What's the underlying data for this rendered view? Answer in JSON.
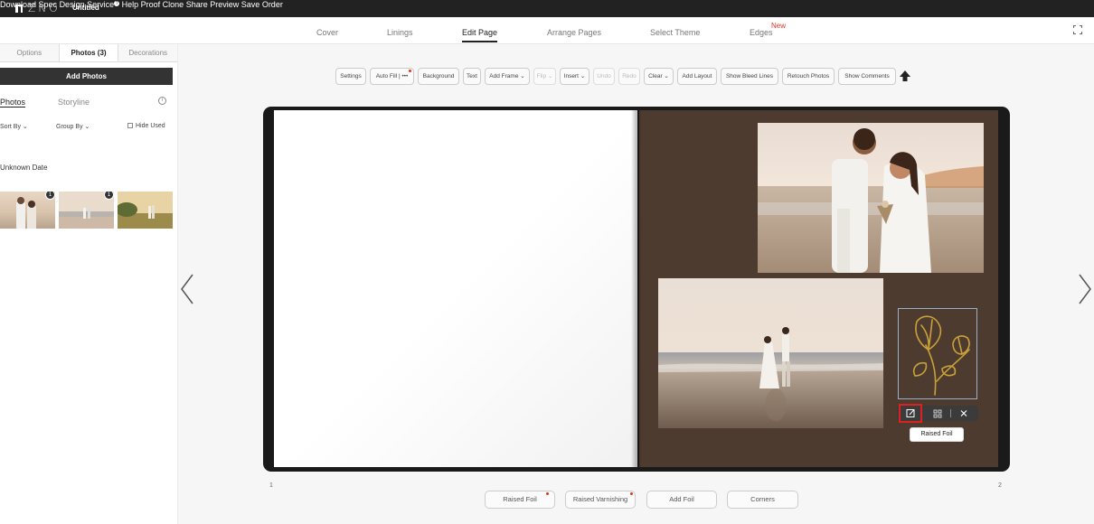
{
  "app": {
    "logo_text": "ZNO",
    "doc_title": "Untitled"
  },
  "top_menu": [
    {
      "label": "Download Spec"
    },
    {
      "label": "Design Service",
      "info": "?"
    },
    {
      "label": "Help"
    },
    {
      "label": "Proof"
    },
    {
      "label": "Clone"
    },
    {
      "label": "Share"
    },
    {
      "label": "Preview"
    },
    {
      "label": "Save"
    },
    {
      "label": "Order"
    }
  ],
  "tabs": [
    {
      "label": "Cover"
    },
    {
      "label": "Linings"
    },
    {
      "label": "Edit Page",
      "active": true
    },
    {
      "label": "Arrange Pages"
    },
    {
      "label": "Select Theme"
    },
    {
      "label": "Edges",
      "badge": "New"
    }
  ],
  "sidebar": {
    "tabs": [
      "Options",
      "Photos (3)",
      "Decorations"
    ],
    "add_photos": "Add Photos",
    "sub_tabs": [
      "Photos",
      "Storyline"
    ],
    "info_glyph": "i",
    "sort_by": "Sort By ⌄",
    "group_by": "Group By ⌄",
    "hide_used": "Hide Used",
    "date_group": "Unknown Date",
    "thumbs": [
      {
        "badge": "1"
      },
      {
        "badge": "1"
      },
      {
        "badge": ""
      }
    ]
  },
  "toolbar": [
    {
      "label": "Settings"
    },
    {
      "label": "Auto Fill | •••",
      "dot": true
    },
    {
      "label": "Background"
    },
    {
      "label": "Text"
    },
    {
      "label": "Add Frame ⌄"
    },
    {
      "label": "Flip ⌄",
      "disabled": true
    },
    {
      "label": "Insert ⌄"
    },
    {
      "label": "Undo",
      "disabled": true
    },
    {
      "label": "Redo",
      "disabled": true
    },
    {
      "label": "Clear ⌄"
    },
    {
      "label": "Add Layout"
    },
    {
      "label": "Show Bleed Lines"
    },
    {
      "label": "Retouch Photos"
    },
    {
      "label": "Show Comments"
    }
  ],
  "canvas": {
    "tooltip": "Raised Foil",
    "page_numbers": [
      "1",
      "2"
    ],
    "colors": {
      "right_page": "#4e3b30",
      "foil": "#c9a13a",
      "highlight": "#e0201e"
    }
  },
  "bottom_buttons": [
    {
      "label": "Raised Foil",
      "dot": true
    },
    {
      "label": "Raised Varnishing",
      "dot": true
    },
    {
      "label": "Add Foil"
    },
    {
      "label": "Corners"
    }
  ]
}
